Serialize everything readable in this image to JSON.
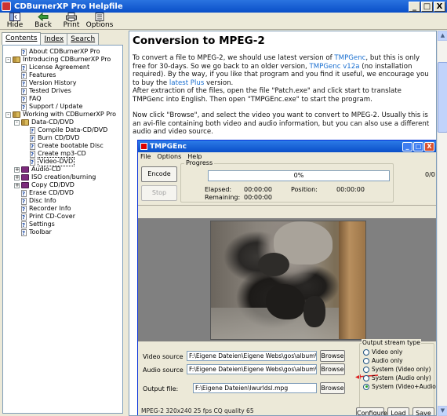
{
  "window": {
    "title": "CDBurnerXP Pro Helpfile",
    "minimize": "_",
    "maximize": "□",
    "close": "X"
  },
  "toolbar": {
    "hide": "Hide",
    "back": "Back",
    "print": "Print",
    "options": "Options"
  },
  "tabs": {
    "contents": "Contents",
    "index": "Index",
    "search": "Search"
  },
  "tree": [
    {
      "label": "About CDBurnerXP Pro",
      "level": 1,
      "icon": "page",
      "expander": ""
    },
    {
      "label": "Introducing CDBurnerXP Pro",
      "level": 0,
      "icon": "book-open",
      "expander": "-"
    },
    {
      "label": "License Agreement",
      "level": 1,
      "icon": "page",
      "expander": ""
    },
    {
      "label": "Features",
      "level": 1,
      "icon": "page",
      "expander": ""
    },
    {
      "label": "Version History",
      "level": 1,
      "icon": "page",
      "expander": ""
    },
    {
      "label": "Tested Drives",
      "level": 1,
      "icon": "page",
      "expander": ""
    },
    {
      "label": "FAQ",
      "level": 1,
      "icon": "page",
      "expander": ""
    },
    {
      "label": "Support / Update",
      "level": 1,
      "icon": "page",
      "expander": ""
    },
    {
      "label": "Working with CDBurnerXP Pro",
      "level": 0,
      "icon": "book-open",
      "expander": "-"
    },
    {
      "label": "Data-CD/DVD",
      "level": 1,
      "icon": "book-open",
      "expander": "-"
    },
    {
      "label": "Compile Data-CD/DVD",
      "level": 2,
      "icon": "page",
      "expander": ""
    },
    {
      "label": "Burn CD/DVD",
      "level": 2,
      "icon": "page",
      "expander": ""
    },
    {
      "label": "Create bootable Disc",
      "level": 2,
      "icon": "page",
      "expander": ""
    },
    {
      "label": "Create mp3-CD",
      "level": 2,
      "icon": "page",
      "expander": ""
    },
    {
      "label": "Video-DVD",
      "level": 2,
      "icon": "page",
      "expander": "",
      "selected": true
    },
    {
      "label": "Audio-CD",
      "level": 1,
      "icon": "book",
      "expander": "+"
    },
    {
      "label": "ISO creation/burning",
      "level": 1,
      "icon": "book",
      "expander": "+"
    },
    {
      "label": "Copy CD/DVD",
      "level": 1,
      "icon": "book",
      "expander": "+"
    },
    {
      "label": "Erase CD/DVD",
      "level": 1,
      "icon": "page",
      "expander": ""
    },
    {
      "label": "Disc Info",
      "level": 1,
      "icon": "page",
      "expander": ""
    },
    {
      "label": "Recorder Info",
      "level": 1,
      "icon": "page",
      "expander": ""
    },
    {
      "label": "Print CD-Cover",
      "level": 1,
      "icon": "page",
      "expander": ""
    },
    {
      "label": "Settings",
      "level": 1,
      "icon": "page",
      "expander": ""
    },
    {
      "label": "Toolbar",
      "level": 1,
      "icon": "page",
      "expander": ""
    }
  ],
  "article": {
    "title": "Conversion to MPEG-2",
    "p1_a": "To convert a file to MPEG-2, we should use latest version of ",
    "p1_link1": "TMPGenc",
    "p1_b": ", but this is only free for 30-days. So we go back to an older version, ",
    "p1_link2": "TMPGenc v12a",
    "p1_c": " (no installation required). By the way, if you like that program and you find it useful, we encourage you to buy the ",
    "p1_link3": "latest Plus",
    "p1_d": " version.",
    "p2": "After extraction of the files, open the file \"Patch.exe\" and click start to translate TMPGenc into English. Then open \"TMPGEnc.exe\" to start the program.",
    "p3": "Now click \"Browse\", and select the video you want to convert to MPEG-2. Usually this is an avi-file containing both video and audio information, but you can also use a different audio and video source."
  },
  "tmpgenc": {
    "title": "TMPGEnc",
    "menu": {
      "file": "File",
      "options": "Options",
      "help": "Help"
    },
    "encode": "Encode",
    "stop": "Stop",
    "progress_label": "Progress",
    "progress_value": "0%",
    "progress_count": "0/0",
    "elapsed_label": "Elapsed:",
    "elapsed_value": "00:00:00",
    "remaining_label": "Remaining:",
    "remaining_value": "00:00:00",
    "position_label": "Position:",
    "position_value": "00:00:00",
    "video_source_label": "Video source",
    "video_source_value": "F:\\Eigene Dateien\\Eigene Webs\\gos\\album\\videos\\l",
    "audio_source_label": "Audio source",
    "audio_source_value": "F:\\Eigene Dateien\\Eigene Webs\\gos\\album\\videos\\l",
    "output_label": "Output file:",
    "output_value": "F:\\Eigene Dateien\\lwurldsl.mpg",
    "browse": "Browse",
    "stream_type_label": "Output stream type",
    "stream_options": [
      {
        "label": "Video only",
        "selected": false
      },
      {
        "label": "Audio only",
        "selected": false
      },
      {
        "label": "System (Video only)",
        "selected": false
      },
      {
        "label": "System (Audio only)",
        "selected": false
      },
      {
        "label": "System (Video+Audio)",
        "selected": true
      }
    ],
    "status": "MPEG-2 320x240 25 fps CQ quality 65",
    "configure": "Configure",
    "load": "Load",
    "save": "Save"
  },
  "colors": {
    "accent": "#0A4FC8",
    "link": "#1A6FD0",
    "arrow": "#E02020"
  }
}
